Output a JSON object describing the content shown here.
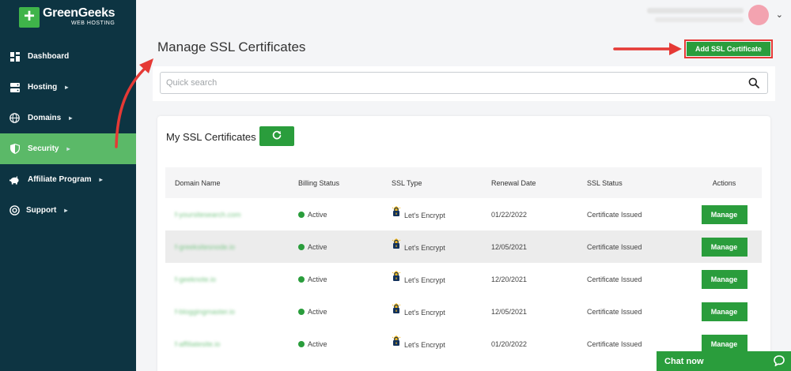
{
  "brand": {
    "name": "GreenGeeks",
    "sub": "WEB HOSTING",
    "plus": "+"
  },
  "nav": [
    {
      "label": "Dashboard",
      "icon": "dashboard-icon",
      "chevron": ""
    },
    {
      "label": "Hosting",
      "icon": "server-icon",
      "chevron": "▸"
    },
    {
      "label": "Domains",
      "icon": "globe-icon",
      "chevron": "▸"
    },
    {
      "label": "Security",
      "icon": "shield-icon",
      "chevron": "▸",
      "active": true
    },
    {
      "label": "Affiliate Program",
      "icon": "piggy-bank-icon",
      "chevron": "▸"
    },
    {
      "label": "Support",
      "icon": "support-icon",
      "chevron": "▸"
    }
  ],
  "header": {
    "caret": "⌄"
  },
  "page": {
    "title": "Manage SSL Certificates",
    "add_button": "Add SSL Certificate",
    "search_placeholder": "Quick search"
  },
  "card": {
    "title": "My SSL Certificates",
    "columns": [
      "Domain Name",
      "Billing Status",
      "SSL Type",
      "Renewal Date",
      "SSL Status",
      "Actions"
    ],
    "rows": [
      {
        "domain": "f-yoursitesearch.com",
        "billing": "Active",
        "ssl_type": "Let's Encrypt",
        "renewal": "01/22/2022",
        "status": "Certificate Issued",
        "action": "Manage"
      },
      {
        "domain": "f-greeksitesnode.io",
        "billing": "Active",
        "ssl_type": "Let's Encrypt",
        "renewal": "12/05/2021",
        "status": "Certificate Issued",
        "action": "Manage"
      },
      {
        "domain": "f-geeknote.io",
        "billing": "Active",
        "ssl_type": "Let's Encrypt",
        "renewal": "12/20/2021",
        "status": "Certificate Issued",
        "action": "Manage"
      },
      {
        "domain": "f-bloggingmaster.io",
        "billing": "Active",
        "ssl_type": "Let's Encrypt",
        "renewal": "12/05/2021",
        "status": "Certificate Issued",
        "action": "Manage"
      },
      {
        "domain": "f-affiliatesite.io",
        "billing": "Active",
        "ssl_type": "Let's Encrypt",
        "renewal": "01/20/2022",
        "status": "Certificate Issued",
        "action": "Manage"
      }
    ]
  },
  "chat": {
    "label": "Chat now"
  },
  "colors": {
    "sidebar": "#0d3442",
    "active": "#5bb968",
    "accent": "#2a9d3c",
    "annotation": "#e53935"
  }
}
